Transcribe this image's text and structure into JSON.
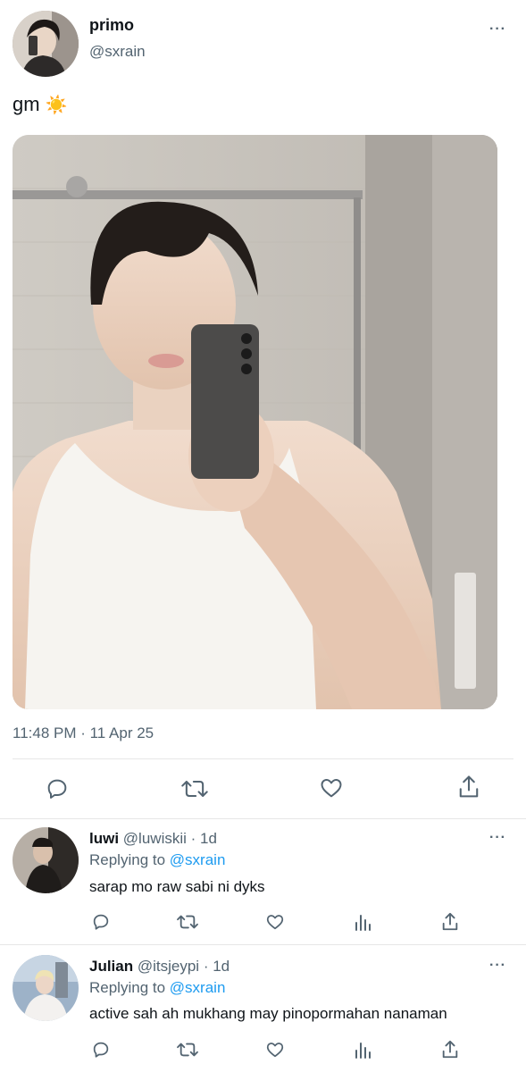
{
  "tweet": {
    "author_name": "primo",
    "author_handle": "@sxrain",
    "text": "gm",
    "emoji": "☀️",
    "timestamp": "11:48 PM · 11 Apr 25",
    "more_label": "···"
  },
  "replies": [
    {
      "name": "luwi",
      "handle": "@luwiskii",
      "age": "· 1d",
      "replying_label": "Replying to",
      "replying_handle": "@sxrain",
      "text": "sarap mo raw sabi ni dyks",
      "more_label": "···"
    },
    {
      "name": "Julian",
      "handle": "@itsjeypi",
      "age": "· 1d",
      "replying_label": "Replying to",
      "replying_handle": "@sxrain",
      "text": "active sah ah mukhang may pinopormahan nanaman",
      "more_label": "···"
    }
  ],
  "colors": {
    "accent": "#1d9bf0",
    "muted": "#536471",
    "divider": "#e7e7e7"
  }
}
